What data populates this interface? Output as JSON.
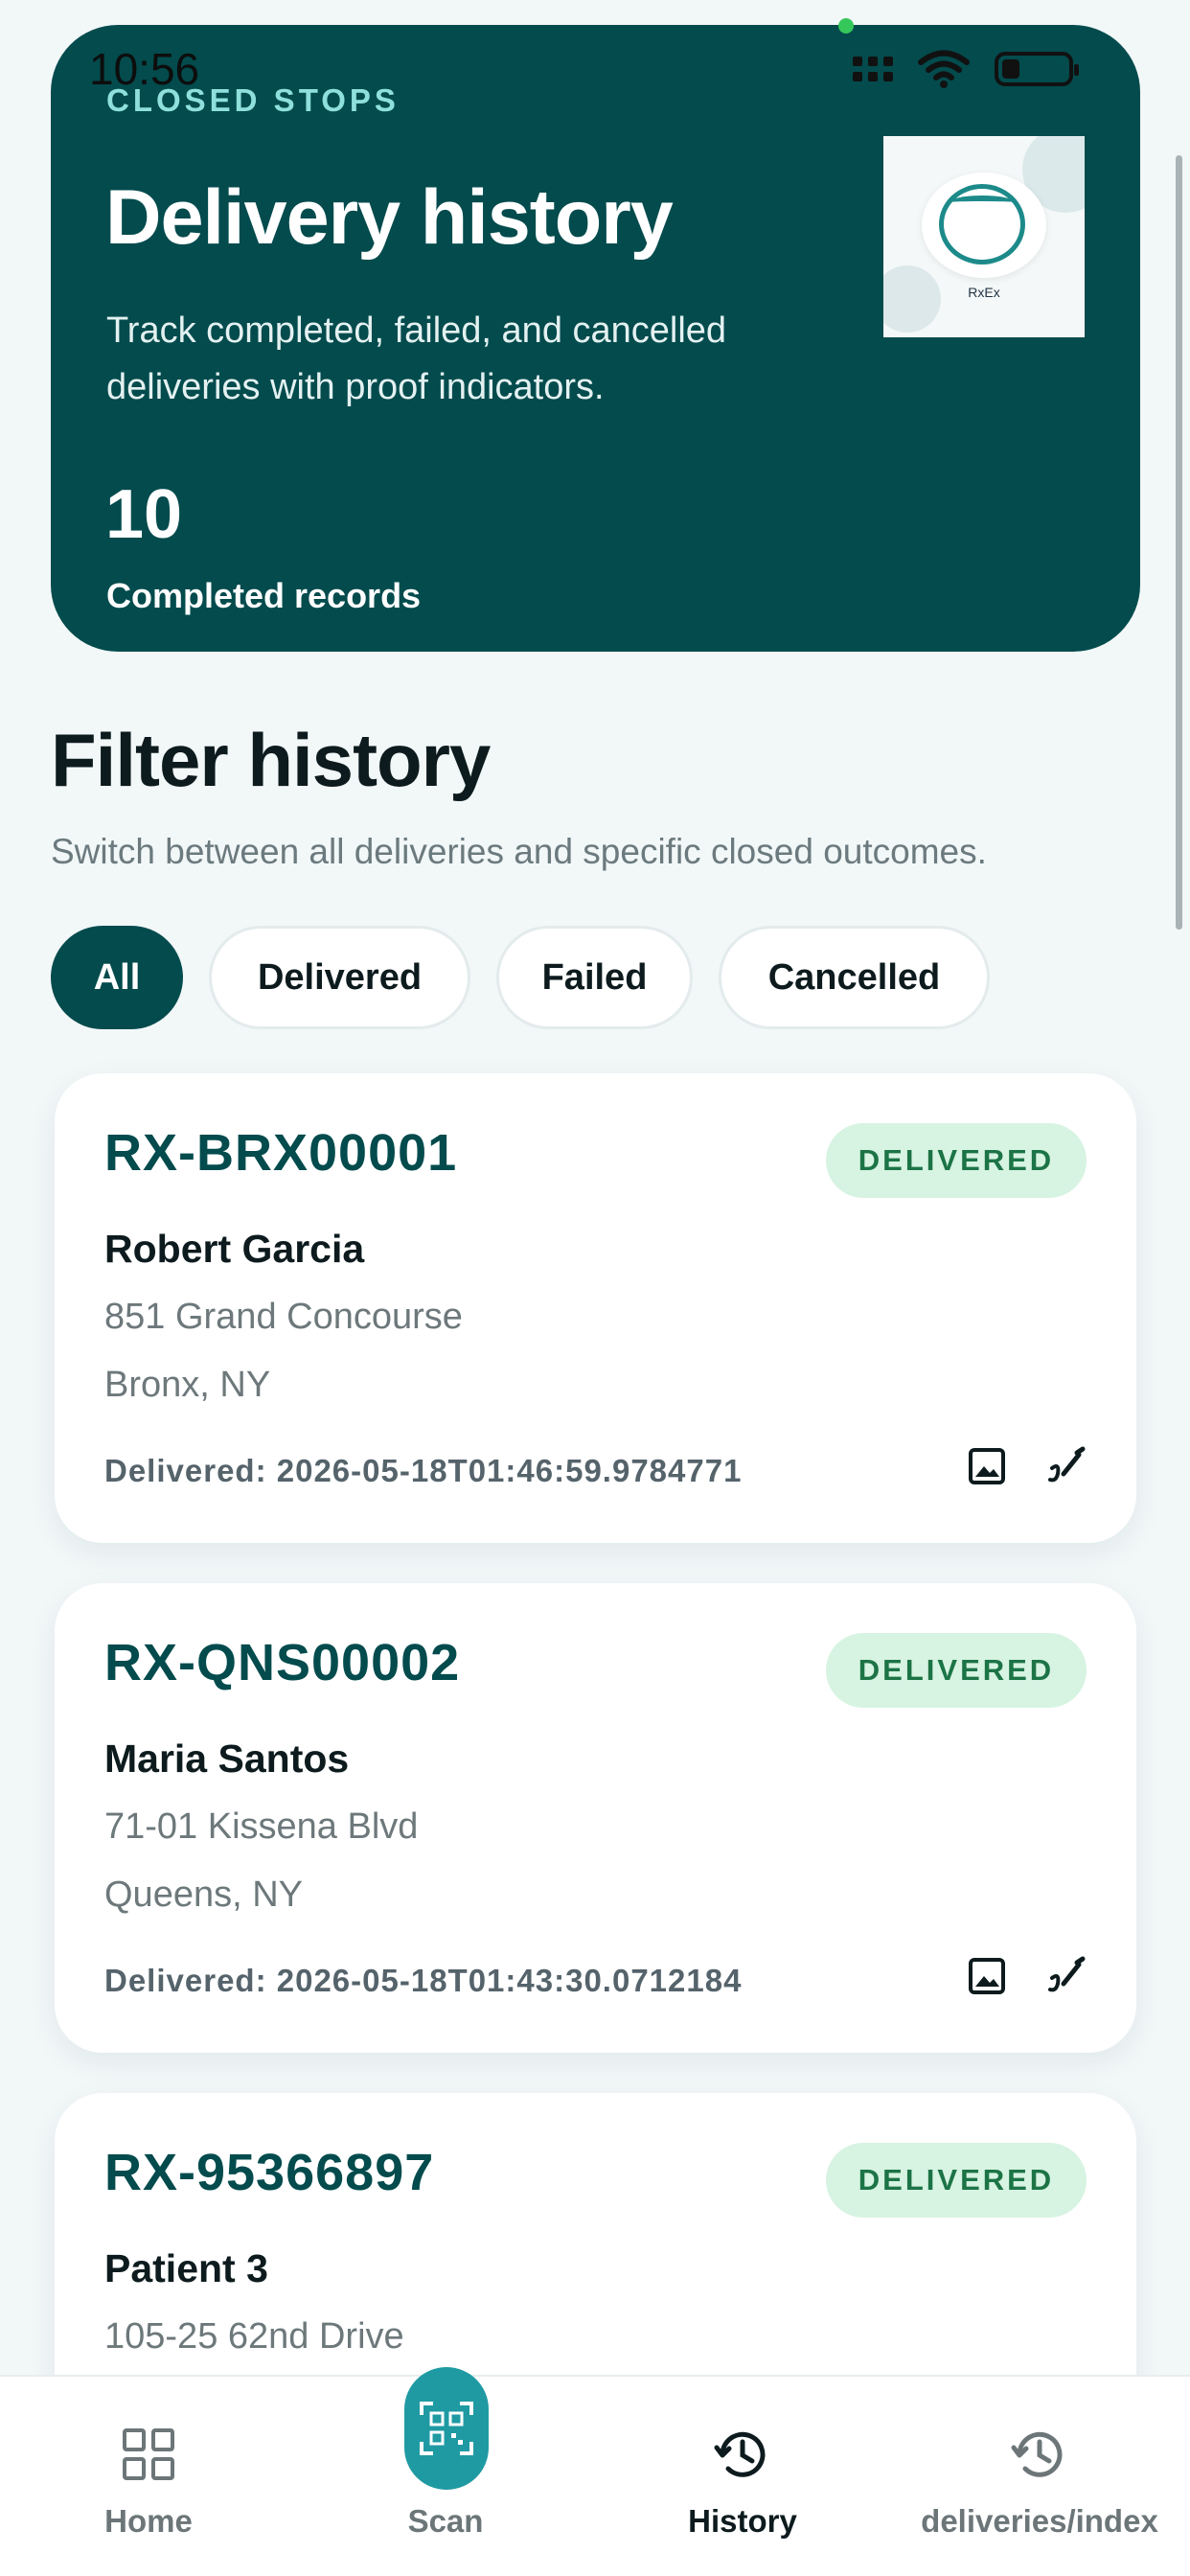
{
  "status_bar": {
    "time": "10:56"
  },
  "hero": {
    "eyebrow": "CLOSED STOPS",
    "title": "Delivery history",
    "description": "Track completed, failed, and cancelled deliveries with proof indicators.",
    "count": "10",
    "count_label": "Completed records",
    "logo_text": "RxEx"
  },
  "filter": {
    "title": "Filter history",
    "subtitle": "Switch between all deliveries and specific closed outcomes.",
    "chips": [
      {
        "label": "All",
        "active": true
      },
      {
        "label": "Delivered",
        "active": false
      },
      {
        "label": "Failed",
        "active": false
      },
      {
        "label": "Cancelled",
        "active": false
      }
    ]
  },
  "deliveries": [
    {
      "id": "RX-BRX00001",
      "status": "DELIVERED",
      "name": "Robert Garcia",
      "address": "851 Grand Concourse",
      "city": "Bronx, NY",
      "delivered_at": "Delivered: 2026-05-18T01:46:59.9784771"
    },
    {
      "id": "RX-QNS00002",
      "status": "DELIVERED",
      "name": "Maria Santos",
      "address": "71-01 Kissena Blvd",
      "city": "Queens, NY",
      "delivered_at": "Delivered: 2026-05-18T01:43:30.0712184"
    },
    {
      "id": "RX-95366897",
      "status": "DELIVERED",
      "name": "Patient 3",
      "address": "105-25 62nd Drive",
      "city": "",
      "delivered_at": ""
    }
  ],
  "nav": [
    {
      "label": "Home",
      "icon": "grid-icon",
      "active": false
    },
    {
      "label": "Scan",
      "icon": "qr-scan-icon",
      "active": false
    },
    {
      "label": "History",
      "icon": "history-icon",
      "active": true
    },
    {
      "label": "deliveries/index",
      "icon": "history-icon",
      "active": false
    }
  ],
  "colors": {
    "brand": "#034b4d",
    "accent": "#1f9aa3",
    "badge_bg": "#d7f3e2",
    "badge_text": "#1c7446",
    "background": "#f2f7f8"
  }
}
